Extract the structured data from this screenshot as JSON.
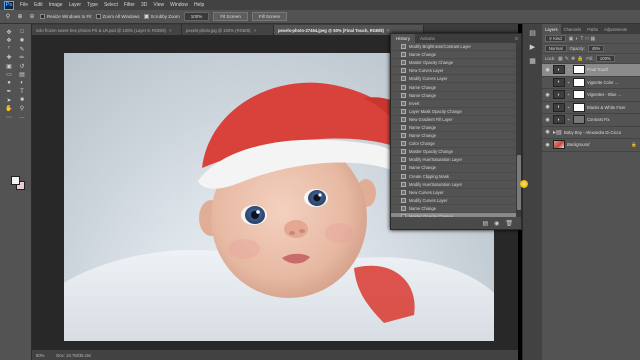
{
  "menubar": {
    "logo": "Ps",
    "items": [
      "File",
      "Edit",
      "Image",
      "Layer",
      "Type",
      "Select",
      "Filter",
      "3D",
      "View",
      "Window",
      "Help"
    ]
  },
  "options": {
    "resize_windows": "Resize Windows to Fit",
    "zoom_all_windows": "Zoom All Windows",
    "scrubby_zoom": "Scrubby Zoom",
    "zoom_level": "100%",
    "fit_screen": "Fit Screen",
    "fill_screen": "Fill Screen"
  },
  "tabs": [
    {
      "label": "solo frozen sweet tree photos PS & LR.psd @ 100% (Layer 8, RGB/8)",
      "active": false
    },
    {
      "label": "pexels-photo.jpg @ 100% (RGB/8)",
      "active": false
    },
    {
      "label": "pexels-photo-27464.jpeg @ 50% (Final Touch, RGB/8)",
      "active": true
    }
  ],
  "status": {
    "zoom": "50%",
    "doc": "Doc: 10.7M/35.1M"
  },
  "history": {
    "tabs": [
      "History",
      "Actions"
    ],
    "items": [
      "Modify Brightness/Contrast Layer",
      "Name Change",
      "Master Opacity Change",
      "New Curves Layer",
      "Modify Curves Layer",
      "Name Change",
      "Name Change",
      "Invert",
      "Layer Mask Opacity Change",
      "New Gradient Fill Layer",
      "Name Change",
      "Name Change",
      "Color Change",
      "Master Opacity Change",
      "Modify Hue/Saturation Layer",
      "Name Change",
      "Create Clipping Mask",
      "Modify Hue/Saturation Layer",
      "New Curves Layer",
      "Modify Curves Layer",
      "Name Change",
      "Master Opacity Change"
    ],
    "selected_index": 21
  },
  "layers": {
    "tabs": [
      "Layers",
      "Channels",
      "Paths",
      "Adjustments"
    ],
    "kind_label": "Kind",
    "blend_mode": "Normal",
    "opacity_label": "Opacity:",
    "opacity_value": "45%",
    "lock_label": "Lock:",
    "fill_label": "Fill:",
    "fill_value": "100%",
    "list": [
      {
        "name": "Final Touch",
        "thumb": "white",
        "visible": true,
        "selected": true,
        "italic": false
      },
      {
        "name": "Vignette Color ...",
        "thumb": "white",
        "visible": false,
        "selected": false,
        "italic": false
      },
      {
        "name": "Vignettes - Blue ...",
        "thumb": "white",
        "visible": true,
        "selected": false,
        "italic": false
      },
      {
        "name": "Blacks & White Fixer",
        "thumb": "white",
        "visible": true,
        "selected": false,
        "italic": false
      },
      {
        "name": "Contrast Fix",
        "thumb": "grey",
        "visible": true,
        "selected": false,
        "italic": false
      },
      {
        "name": "Baby Boy - Alexandra Di Cicco",
        "thumb": "folder",
        "visible": true,
        "selected": false,
        "italic": false
      },
      {
        "name": "Background",
        "thumb": "photo",
        "visible": true,
        "selected": false,
        "italic": true
      }
    ]
  },
  "colors": {
    "foreground": "#f4f4f4",
    "background": "#efc9d5",
    "hat_red": "#d9423a",
    "eye_blue": "#3a5a8c"
  }
}
